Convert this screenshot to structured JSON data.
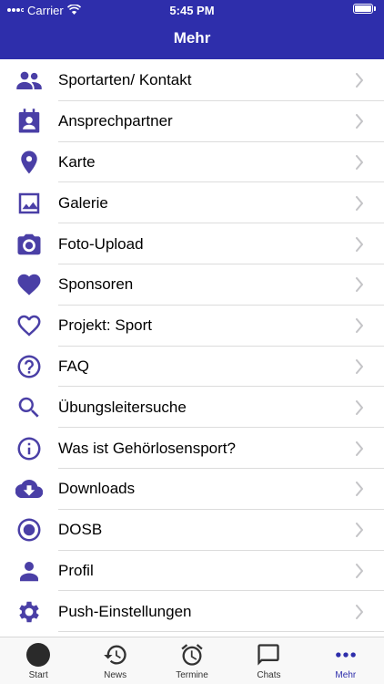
{
  "status": {
    "carrier": "Carrier",
    "time": "5:45 PM"
  },
  "nav": {
    "title": "Mehr"
  },
  "colors": {
    "accent": "#4a3fa6",
    "header": "#2e2eab"
  },
  "menu": [
    {
      "label": "Sportarten/ Kontakt",
      "icon": "people-icon"
    },
    {
      "label": "Ansprechpartner",
      "icon": "contact-book-icon"
    },
    {
      "label": "Karte",
      "icon": "map-pin-icon"
    },
    {
      "label": "Galerie",
      "icon": "image-icon"
    },
    {
      "label": "Foto-Upload",
      "icon": "camera-icon"
    },
    {
      "label": "Sponsoren",
      "icon": "heart-filled-icon"
    },
    {
      "label": "Projekt: Sport",
      "icon": "heart-outline-icon"
    },
    {
      "label": "FAQ",
      "icon": "question-icon"
    },
    {
      "label": "Übungsleitersuche",
      "icon": "search-icon"
    },
    {
      "label": "Was ist Gehörlosensport?",
      "icon": "info-icon"
    },
    {
      "label": "Downloads",
      "icon": "cloud-download-icon"
    },
    {
      "label": "DOSB",
      "icon": "radio-circle-icon"
    },
    {
      "label": "Profil",
      "icon": "person-icon"
    },
    {
      "label": "Push-Einstellungen",
      "icon": "gear-icon"
    }
  ],
  "tabs": [
    {
      "label": "Start",
      "icon": "start-dot-icon"
    },
    {
      "label": "News",
      "icon": "history-icon"
    },
    {
      "label": "Termine",
      "icon": "alarm-clock-icon"
    },
    {
      "label": "Chats",
      "icon": "chat-bubble-icon"
    },
    {
      "label": "Mehr",
      "icon": "more-dots-icon",
      "active": true
    }
  ]
}
